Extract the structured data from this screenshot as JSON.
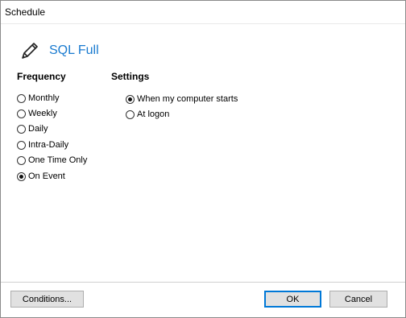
{
  "window": {
    "title": "Schedule"
  },
  "header": {
    "icon": "pencil-icon",
    "title": "SQL Full"
  },
  "frequency": {
    "title": "Frequency",
    "options": [
      {
        "label": "Monthly",
        "checked": false
      },
      {
        "label": "Weekly",
        "checked": false
      },
      {
        "label": "Daily",
        "checked": false
      },
      {
        "label": "Intra-Daily",
        "checked": false
      },
      {
        "label": "One Time Only",
        "checked": false
      },
      {
        "label": "On Event",
        "checked": true
      }
    ]
  },
  "settings": {
    "title": "Settings",
    "options": [
      {
        "label": "When my computer starts",
        "checked": true
      },
      {
        "label": "At logon",
        "checked": false
      }
    ]
  },
  "buttons": {
    "conditions": "Conditions...",
    "ok": "OK",
    "cancel": "Cancel"
  },
  "colors": {
    "accent": "#1a7bd0",
    "default_button_border": "#0078d7"
  }
}
